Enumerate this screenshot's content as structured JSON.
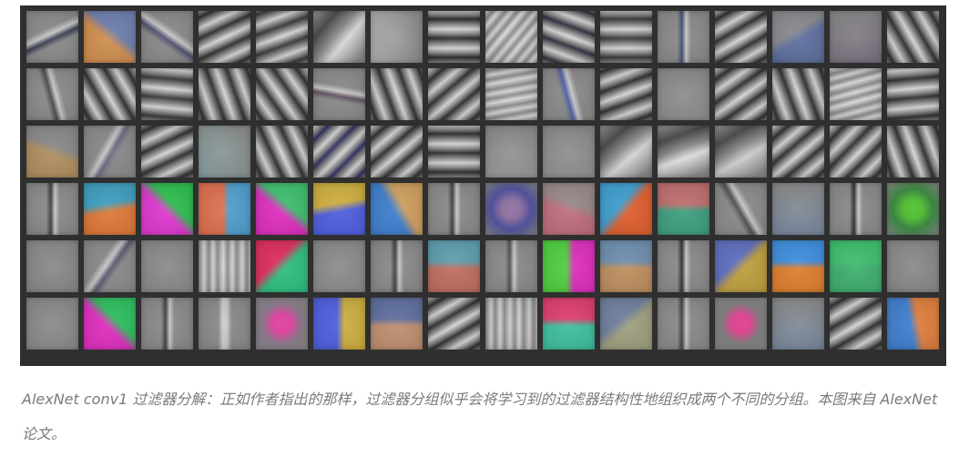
{
  "figure": {
    "rows": 6,
    "cols": 16,
    "filters": [
      {
        "t": "stripe",
        "a": -25,
        "c": "#384050"
      },
      {
        "t": "color",
        "c1": "#d09050",
        "c2": "#7080b0",
        "a": 40
      },
      {
        "t": "stripe",
        "a": 35,
        "c": "#505070"
      },
      {
        "t": "stripes",
        "a": -25,
        "c": "#303030"
      },
      {
        "t": "stripes",
        "a": -20,
        "c": "#3a3a3a"
      },
      {
        "t": "blob",
        "a": -50,
        "c": "#dcdcdc"
      },
      {
        "t": "soft",
        "a": 90,
        "c": "#b0b0b0"
      },
      {
        "t": "stripes",
        "a": 0,
        "c": "#2c2c2c"
      },
      {
        "t": "stripes",
        "a": -50,
        "c": "#dedede"
      },
      {
        "t": "stripes",
        "a": 20,
        "c": "#303040"
      },
      {
        "t": "stripes",
        "a": 0,
        "c": "#3a3a3a"
      },
      {
        "t": "stripe",
        "a": 90,
        "c": "#405070"
      },
      {
        "t": "stripes",
        "a": -30,
        "c": "#303030"
      },
      {
        "t": "color",
        "c1": "#6070a0",
        "c2": "#8a8a90",
        "a": -30
      },
      {
        "t": "soft",
        "a": -15,
        "c": "#7a7080"
      },
      {
        "t": "stripes",
        "a": 60,
        "c": "#303030"
      },
      {
        "t": "stripe",
        "a": 75,
        "c": "#4a4a4a"
      },
      {
        "t": "stripes",
        "a": 60,
        "c": "#303030"
      },
      {
        "t": "stripes",
        "a": 5,
        "c": "#3a3a3a"
      },
      {
        "t": "stripes",
        "a": 70,
        "c": "#303030"
      },
      {
        "t": "stripes",
        "a": 55,
        "c": "#303030"
      },
      {
        "t": "stripe",
        "a": 10,
        "c": "#605060"
      },
      {
        "t": "stripes",
        "a": 70,
        "c": "#303030"
      },
      {
        "t": "stripes",
        "a": -40,
        "c": "#303030"
      },
      {
        "t": "stripes",
        "a": -10,
        "c": "#dcdcdc"
      },
      {
        "t": "stripe",
        "a": 75,
        "c": "#5060a0"
      },
      {
        "t": "stripes",
        "a": -20,
        "c": "#303030"
      },
      {
        "t": "soft",
        "a": 0,
        "c": "#909090"
      },
      {
        "t": "stripes",
        "a": -35,
        "c": "#303030"
      },
      {
        "t": "stripes",
        "a": 70,
        "c": "#303030"
      },
      {
        "t": "stripes",
        "a": -15,
        "c": "#dddddd"
      },
      {
        "t": "stripes",
        "a": -5,
        "c": "#303030"
      },
      {
        "t": "color",
        "c1": "#b09060",
        "c2": "#8a8a8a",
        "a": 20
      },
      {
        "t": "stripe",
        "a": -60,
        "c": "#6a6a80"
      },
      {
        "t": "stripes",
        "a": -25,
        "c": "#303030"
      },
      {
        "t": "soft",
        "a": 60,
        "c": "#8aa0a0"
      },
      {
        "t": "stripes",
        "a": 65,
        "c": "#303030"
      },
      {
        "t": "stripes",
        "a": -45,
        "c": "#303060"
      },
      {
        "t": "stripes",
        "a": -40,
        "c": "#303030"
      },
      {
        "t": "stripes",
        "a": 0,
        "c": "#303030"
      },
      {
        "t": "soft",
        "a": 0,
        "c": "#9a9a9a"
      },
      {
        "t": "soft",
        "a": 0,
        "c": "#949494"
      },
      {
        "t": "blob",
        "a": -40,
        "c": "#d8d8d8"
      },
      {
        "t": "blob",
        "a": -20,
        "c": "#e2e2e2"
      },
      {
        "t": "blob",
        "a": -30,
        "c": "#d0d0d0"
      },
      {
        "t": "stripes",
        "a": -40,
        "c": "#303030"
      },
      {
        "t": "stripes",
        "a": -45,
        "c": "#303030"
      },
      {
        "t": "stripes",
        "a": 70,
        "c": "#303030"
      },
      {
        "t": "stripe",
        "a": 90,
        "c": "#404040"
      },
      {
        "t": "color",
        "c1": "#e07a3a",
        "c2": "#40a0c0",
        "a": -10
      },
      {
        "t": "color",
        "c1": "#e03ad0",
        "c2": "#30c050",
        "a": 45
      },
      {
        "t": "color",
        "c1": "#e07050",
        "c2": "#50a0d0",
        "a": 90
      },
      {
        "t": "color",
        "c1": "#e030c0",
        "c2": "#40c070",
        "a": 40
      },
      {
        "t": "color",
        "c1": "#5060e0",
        "c2": "#d0b040",
        "a": -10
      },
      {
        "t": "color",
        "c1": "#4080d0",
        "c2": "#d0a060",
        "a": 60
      },
      {
        "t": "stripe",
        "a": 90,
        "c": "#404040"
      },
      {
        "t": "dot",
        "c1": "#9070a0",
        "c2": "#5050a0"
      },
      {
        "t": "color",
        "c1": "#c07080",
        "c2": "#9a8a8a",
        "a": 20
      },
      {
        "t": "color",
        "c1": "#e06030",
        "c2": "#40a0d0",
        "a": -50
      },
      {
        "t": "color",
        "c1": "#40a080",
        "c2": "#c07070",
        "a": 0
      },
      {
        "t": "stripe",
        "a": 60,
        "c": "#505050"
      },
      {
        "t": "soft",
        "a": 0,
        "c": "#7a8aa0"
      },
      {
        "t": "stripe",
        "a": 90,
        "c": "#303030"
      },
      {
        "t": "dot",
        "c1": "#50c030",
        "c2": "#3a8a40"
      },
      {
        "t": "soft",
        "a": 0,
        "c": "#8a8a8a"
      },
      {
        "t": "stripe",
        "a": -55,
        "c": "#5a5a70"
      },
      {
        "t": "soft",
        "a": 0,
        "c": "#8c8c8c"
      },
      {
        "t": "stripes",
        "a": 90,
        "c": "#d8d8d8"
      },
      {
        "t": "color",
        "c1": "#30c080",
        "c2": "#e03060",
        "a": -45
      },
      {
        "t": "soft",
        "a": 0,
        "c": "#8e8e8e"
      },
      {
        "t": "stripe",
        "a": 90,
        "c": "#404040"
      },
      {
        "t": "color",
        "c1": "#c07060",
        "c2": "#60a0b0",
        "a": 0
      },
      {
        "t": "stripe",
        "a": 90,
        "c": "#505050"
      },
      {
        "t": "color",
        "c1": "#50d040",
        "c2": "#e030c0",
        "a": 90
      },
      {
        "t": "color",
        "c1": "#c09060",
        "c2": "#7090b0",
        "a": 0
      },
      {
        "t": "stripe",
        "a": 90,
        "c": "#303030"
      },
      {
        "t": "color",
        "c1": "#c0a040",
        "c2": "#6070c0",
        "a": -45
      },
      {
        "t": "color",
        "c1": "#e08030",
        "c2": "#4090e0",
        "a": 0
      },
      {
        "t": "color",
        "c1": "#40b070",
        "c2": "#40c070",
        "a": 0
      },
      {
        "t": "soft",
        "a": 0,
        "c": "#8a8a8a"
      },
      {
        "t": "soft",
        "a": 0,
        "c": "#8c8c8c"
      },
      {
        "t": "color",
        "c1": "#e030c0",
        "c2": "#30c060",
        "a": 45
      },
      {
        "t": "stripe",
        "a": 90,
        "c": "#404040"
      },
      {
        "t": "stripe",
        "a": 90,
        "c": "#d0d0d0"
      },
      {
        "t": "dot",
        "c1": "#e040a0",
        "c2": "#8a7a8a"
      },
      {
        "t": "color",
        "c1": "#5060e0",
        "c2": "#d0b040",
        "a": 90
      },
      {
        "t": "color",
        "c1": "#c09070",
        "c2": "#6070a0",
        "a": 0
      },
      {
        "t": "stripes",
        "a": -30,
        "c": "#303030"
      },
      {
        "t": "stripes",
        "a": 90,
        "c": "#d0d0d0"
      },
      {
        "t": "color",
        "c1": "#40c0a0",
        "c2": "#e04070",
        "a": 0
      },
      {
        "t": "color",
        "c1": "#a0a080",
        "c2": "#7080a0",
        "a": -40
      },
      {
        "t": "stripe",
        "a": 90,
        "c": "#404040"
      },
      {
        "t": "dot",
        "c1": "#e04090",
        "c2": "#808080"
      },
      {
        "t": "soft",
        "a": 0,
        "c": "#7a8aa0"
      },
      {
        "t": "stripes",
        "a": -30,
        "c": "#303030"
      },
      {
        "t": "color",
        "c1": "#4080d0",
        "c2": "#e08040",
        "a": 80
      }
    ]
  },
  "caption": "AlexNet conv1 过滤器分解：正如作者指出的那样，过滤器分组似乎会将学习到的过滤器结构性地组织成两个不同的分组。本图来自 AlexNet 论文。"
}
